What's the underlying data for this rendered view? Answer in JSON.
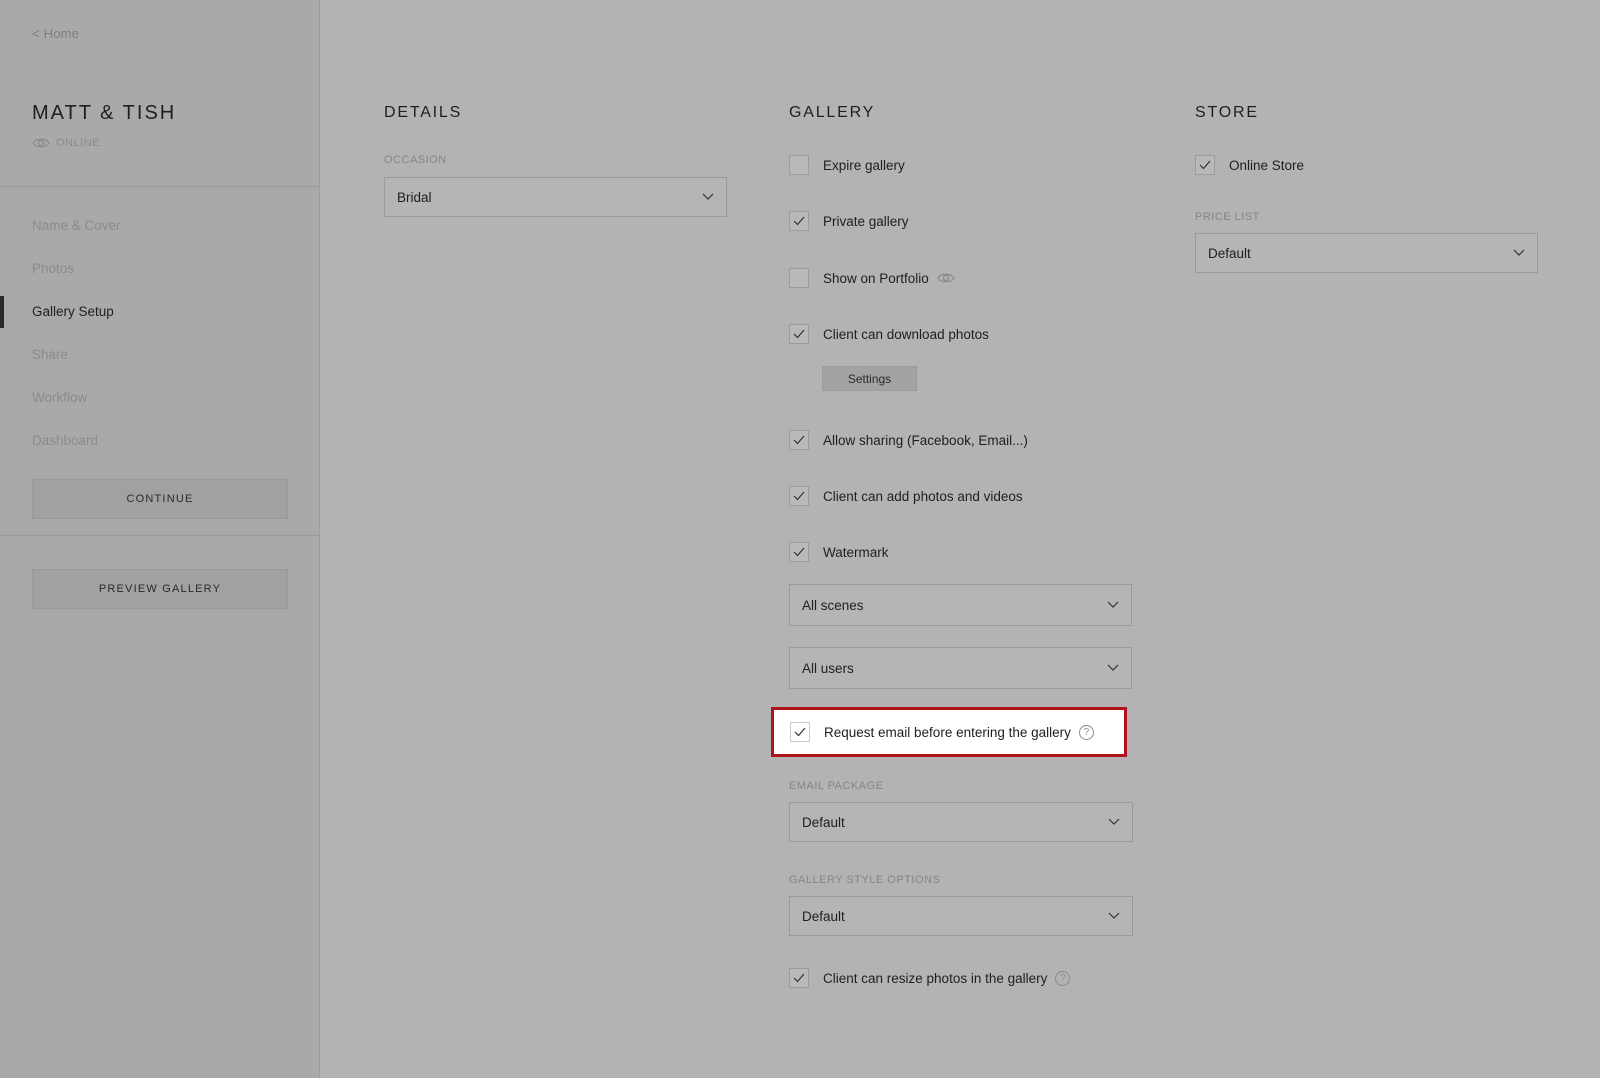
{
  "sidebar": {
    "back_label": "< Home",
    "gallery_name": "MATT & TISH",
    "status": "ONLINE",
    "nav": [
      "Name & Cover",
      "Photos",
      "Gallery Setup",
      "Share",
      "Workflow",
      "Dashboard"
    ],
    "active_nav": "Gallery Setup",
    "continue_label": "CONTINUE",
    "preview_label": "PREVIEW GALLERY"
  },
  "details": {
    "title": "DETAILS",
    "occasion_label": "OCCASION",
    "occasion_value": "Bridal"
  },
  "gallery": {
    "title": "GALLERY",
    "options": {
      "expire": {
        "label": "Expire gallery",
        "checked": false
      },
      "private": {
        "label": "Private gallery",
        "checked": true
      },
      "portfolio": {
        "label": "Show on Portfolio",
        "checked": false
      },
      "download": {
        "label": "Client can download photos",
        "checked": true
      },
      "sharing": {
        "label": "Allow sharing (Facebook, Email...)",
        "checked": true
      },
      "add_photos": {
        "label": "Client can add photos and videos",
        "checked": true
      },
      "watermark": {
        "label": "Watermark",
        "checked": true
      },
      "request_email": {
        "label": "Request email before entering the gallery",
        "checked": true
      },
      "resize": {
        "label": "Client can resize photos in the gallery",
        "checked": true
      }
    },
    "settings_label": "Settings",
    "watermark_scenes": "All scenes",
    "watermark_users": "All users",
    "email_package_label": "EMAIL PACKAGE",
    "email_package_value": "Default",
    "style_options_label": "GALLERY STYLE OPTIONS",
    "style_options_value": "Default"
  },
  "store": {
    "title": "STORE",
    "online_store": {
      "label": "Online Store",
      "checked": true
    },
    "price_list_label": "PRICE LIST",
    "price_list_value": "Default"
  },
  "colors": {
    "highlight_border": "#b0121b",
    "overlay": "#b3b3b3"
  }
}
